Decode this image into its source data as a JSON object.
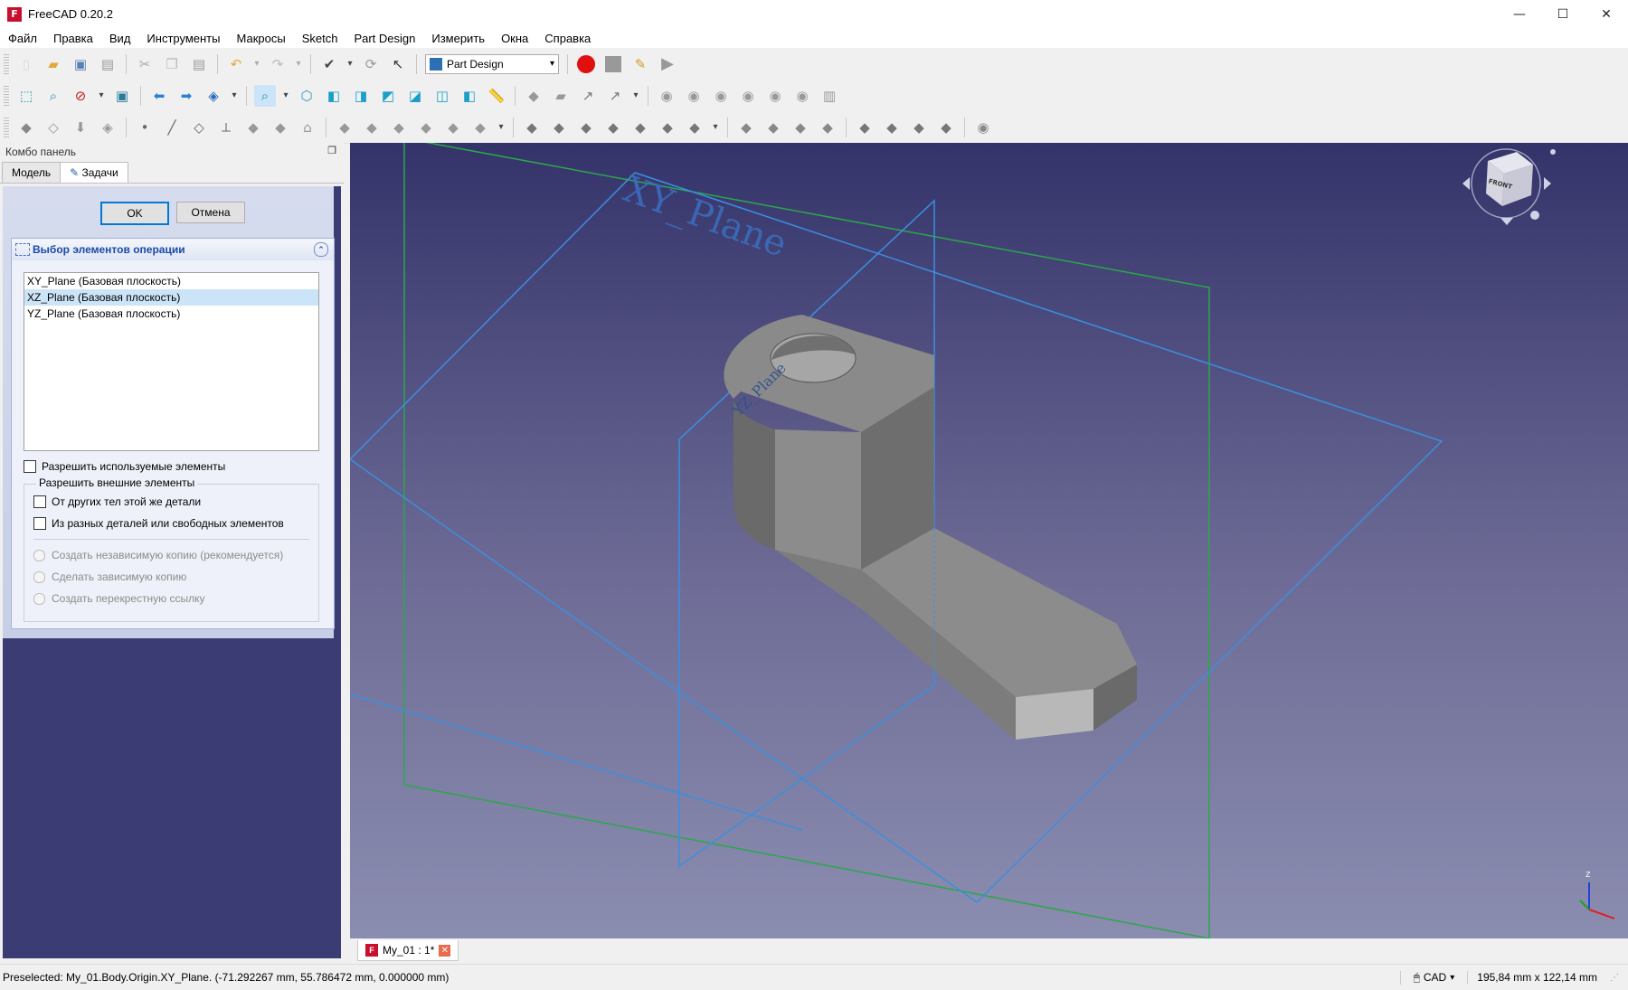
{
  "window": {
    "title": "FreeCAD 0.20.2",
    "controls": [
      "—",
      "☐",
      "✕"
    ]
  },
  "menu": [
    "Файл",
    "Правка",
    "Вид",
    "Инструменты",
    "Макросы",
    "Sketch",
    "Part Design",
    "Измерить",
    "Окна",
    "Справка"
  ],
  "toolbar": {
    "workbench": "Part Design"
  },
  "combo_panel": {
    "title": "Комбо панель",
    "tabs": [
      "Модель",
      "Задачи"
    ],
    "ok_label": "OK",
    "cancel_label": "Отмена",
    "taskbox_title": "Выбор элементов операции",
    "list_items": [
      "XY_Plane (Базовая плоскость)",
      "XZ_Plane (Базовая плоскость)",
      "YZ_Plane (Базовая плоскость)"
    ],
    "selected_index": 1,
    "allow_used": "Разрешить используемые элементы",
    "external_group": "Разрешить внешние элементы",
    "from_other_bodies": "От других тел этой же детали",
    "from_other_parts": "Из разных деталей или свободных элементов",
    "radio_options": [
      "Создать независимую копию (рекомендуется)",
      "Сделать зависимую копию",
      "Создать перекрестную ссылку"
    ]
  },
  "viewport": {
    "plane_labels": [
      "XY_Plane",
      "YZ_Plane"
    ],
    "navcube_face": "FRONT",
    "axis_label": "Z"
  },
  "document_tab": {
    "label": "My_01 : 1*"
  },
  "status": {
    "message": "Preselected: My_01.Body.Origin.XY_Plane. (-71.292267 mm, 55.786472 mm, 0.000000 mm)",
    "nav_style": "CAD",
    "dimensions": "195,84 mm x 122,14 mm"
  }
}
